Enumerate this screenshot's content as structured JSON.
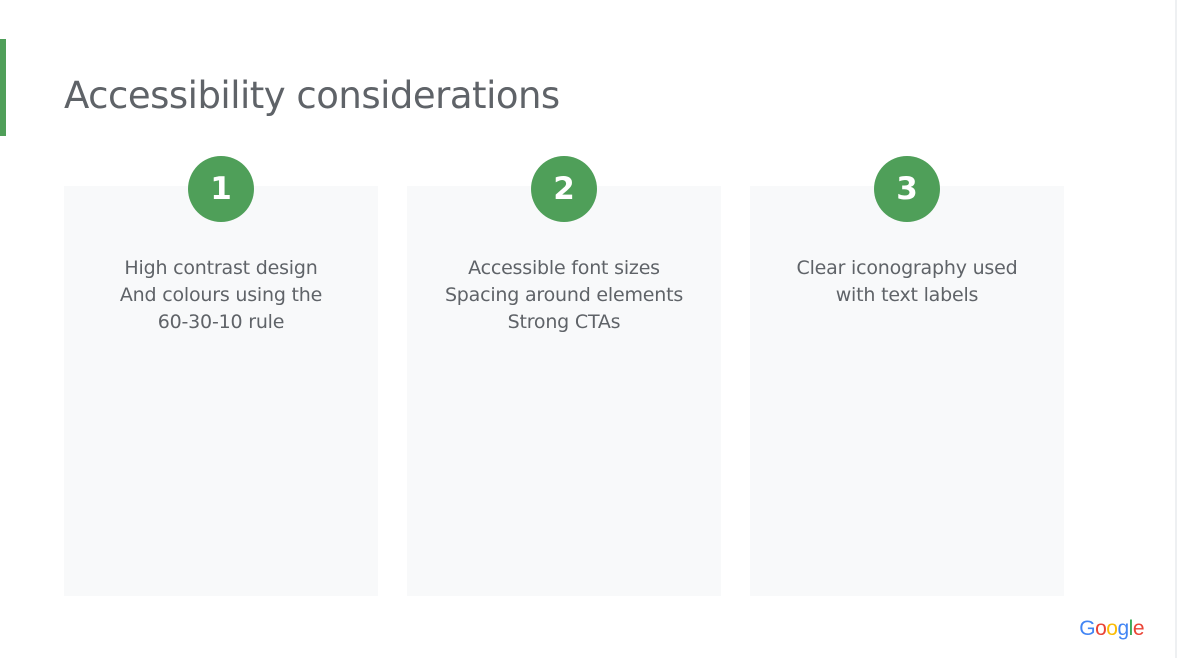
{
  "slide": {
    "title": "Accessibility considerations",
    "accent_color": "#4f9f59",
    "card_background": "#f8f9fa",
    "text_color": "#5f6368"
  },
  "cards": [
    {
      "number": "1",
      "lines": [
        "High contrast design",
        "And colours using the",
        "60-30-10 rule"
      ]
    },
    {
      "number": "2",
      "lines": [
        "Accessible font sizes",
        "Spacing around elements",
        "Strong CTAs"
      ]
    },
    {
      "number": "3",
      "lines": [
        "Clear iconography used",
        "with text labels"
      ]
    }
  ],
  "logo": {
    "name": "google-logo",
    "letters": [
      {
        "char": "G",
        "color": "#4285F4"
      },
      {
        "char": "o",
        "color": "#EA4335"
      },
      {
        "char": "o",
        "color": "#FBBC05"
      },
      {
        "char": "g",
        "color": "#4285F4"
      },
      {
        "char": "l",
        "color": "#34A853"
      },
      {
        "char": "e",
        "color": "#EA4335"
      }
    ]
  }
}
